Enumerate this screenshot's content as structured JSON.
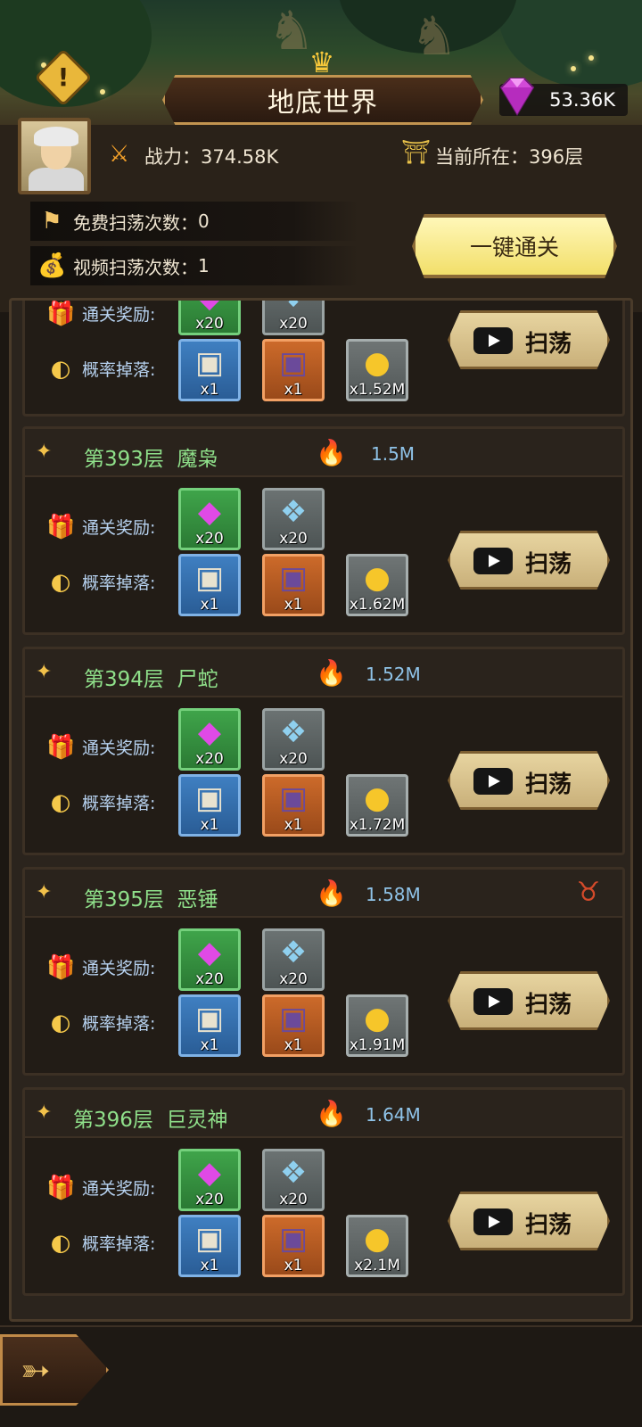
{
  "header": {
    "title": "地底世界",
    "gems": "53.36K",
    "alert_symbol": "!"
  },
  "stats": {
    "power_label": "战力：",
    "power_value": "374.58K",
    "floor_label": "当前所在：",
    "floor_value": "396层",
    "free_sweeps_label": "免费扫荡次数：",
    "free_sweeps_value": "0",
    "video_sweeps_label": "视频扫荡次数：",
    "video_sweeps_value": "1",
    "quick_clear_label": "一键通关"
  },
  "labels": {
    "clear_reward": "通关奖励:",
    "drop": "概率掉落:",
    "sweep": "扫荡"
  },
  "items": {
    "gem_qty": "x20",
    "crystal_qty": "x20",
    "chest_qty": "x1"
  },
  "floors": [
    {
      "coins": "x1.52M"
    },
    {
      "floor": "第393层",
      "name": "魔枭",
      "power": "1.5M",
      "coins": "x1.62M"
    },
    {
      "floor": "第394层",
      "name": "尸蛇",
      "power": "1.52M",
      "coins": "x1.72M"
    },
    {
      "floor": "第395层",
      "name": "恶锤",
      "power": "1.58M",
      "coins": "x1.91M"
    },
    {
      "floor": "第396层",
      "name": "巨灵神",
      "power": "1.64M",
      "coins": "x2.1M"
    }
  ],
  "colors": {
    "floor_text": "#8fe08a",
    "power_text": "#8fc3e8",
    "label_text": "#b7d2f0"
  },
  "icons": [
    "alert-icon",
    "crown-icon",
    "gem-icon",
    "swords-icon",
    "pagoda-icon",
    "flag-icon",
    "money-bag-icon",
    "gift-icon",
    "moon-icon",
    "flame-icon",
    "camera-icon",
    "boss-icon",
    "back-arrow-icon"
  ]
}
